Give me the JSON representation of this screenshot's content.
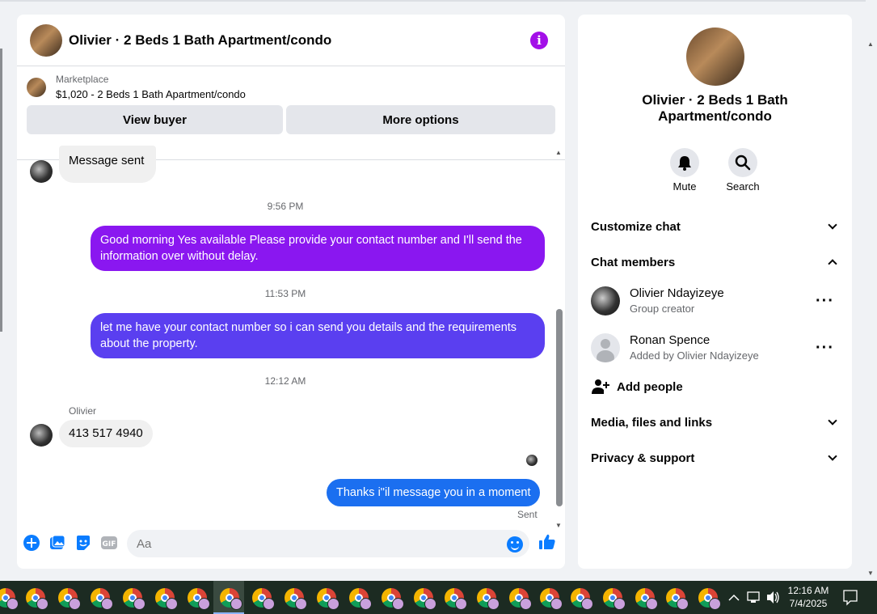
{
  "chat": {
    "title": "Olivier · 2 Beds 1 Bath Apartment/condo",
    "marketplace_label": "Marketplace",
    "listing": "$1,020 - 2 Beds 1 Bath Apartment/condo",
    "view_buyer": "View buyer",
    "more_options": "More options",
    "messages": [
      {
        "type": "in",
        "text": "Message sent"
      },
      {
        "type": "time",
        "text": "9:56 PM"
      },
      {
        "type": "out",
        "text": "Good morning Yes available Please provide your contact number and I'll send the information over without delay."
      },
      {
        "type": "time",
        "text": "11:53 PM"
      },
      {
        "type": "out",
        "text": "let me have your contact number so i can send you details and the requirements about the property."
      },
      {
        "type": "time",
        "text": "12:12 AM"
      },
      {
        "type": "sender",
        "text": "Olivier"
      },
      {
        "type": "in",
        "text": "413 517 4940"
      },
      {
        "type": "out",
        "text": "Thanks i\"il message you in a moment"
      },
      {
        "type": "status",
        "text": "Sent"
      }
    ],
    "composer_placeholder": "Aa",
    "colors": {
      "accent": "#a30fe8",
      "bubble_purple": "#8a17f0",
      "bubble_indigo": "#5a3ff0",
      "bubble_blue": "#1b6ff0"
    }
  },
  "info": {
    "title": "Olivier · 2 Beds 1 Bath Apartment/condo",
    "mute": "Mute",
    "search": "Search",
    "customize": "Customize chat",
    "members_section": "Chat members",
    "members": [
      {
        "name": "Olivier Ndayizeye",
        "role": "Group creator"
      },
      {
        "name": "Ronan Spence",
        "role": "Added by Olivier Ndayizeye"
      }
    ],
    "add_people": "Add people",
    "media": "Media, files and links",
    "privacy": "Privacy & support"
  },
  "taskbar": {
    "time": "12:16 AM",
    "date": "7/4/2025",
    "app_icon": "chrome-profile-icon"
  }
}
